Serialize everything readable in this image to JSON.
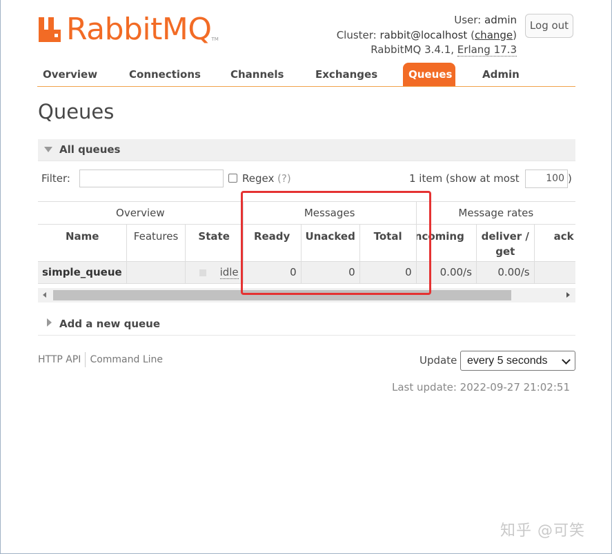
{
  "header": {
    "logo_text": "RabbitMQ",
    "logo_tm": "TM",
    "user_label": "User:",
    "user_value": "admin",
    "cluster_label": "Cluster:",
    "cluster_value": "rabbit@localhost",
    "change_link": "change",
    "version_text": "RabbitMQ 3.4.1,",
    "erlang_text": "Erlang 17.3",
    "logout_label": "Log out"
  },
  "tabs": [
    {
      "label": "Overview"
    },
    {
      "label": "Connections"
    },
    {
      "label": "Channels"
    },
    {
      "label": "Exchanges"
    },
    {
      "label": "Queues",
      "active": true
    },
    {
      "label": "Admin"
    }
  ],
  "page_title": "Queues",
  "section": {
    "label": "All queues"
  },
  "filter": {
    "label": "Filter:",
    "value": "",
    "regex_label": "Regex",
    "regex_help": "(?)",
    "count_text": "1 item (show at most",
    "max_value": "100",
    "close_paren": ")"
  },
  "table": {
    "groups": [
      "Overview",
      "Messages",
      "Message rates"
    ],
    "columns": [
      "Name",
      "Features",
      "State",
      "Ready",
      "Unacked",
      "Total",
      "incoming",
      "deliver / get",
      "ack"
    ],
    "rows": [
      {
        "name": "simple_queue",
        "features": "",
        "state": "idle",
        "ready": "0",
        "unacked": "0",
        "total": "0",
        "incoming": "0.00/s",
        "deliver_get": "0.00/s",
        "ack": ""
      }
    ]
  },
  "add_queue": {
    "label": "Add a new queue"
  },
  "footer": {
    "http_api": "HTTP API",
    "command_line": "Command Line",
    "update_label": "Update",
    "update_value": "every 5 seconds",
    "last_update": "Last update: 2022-09-27 21:02:51"
  },
  "watermark": "知乎 @可笑",
  "colors": {
    "accent": "#f26b25",
    "highlight": "#e53232"
  }
}
